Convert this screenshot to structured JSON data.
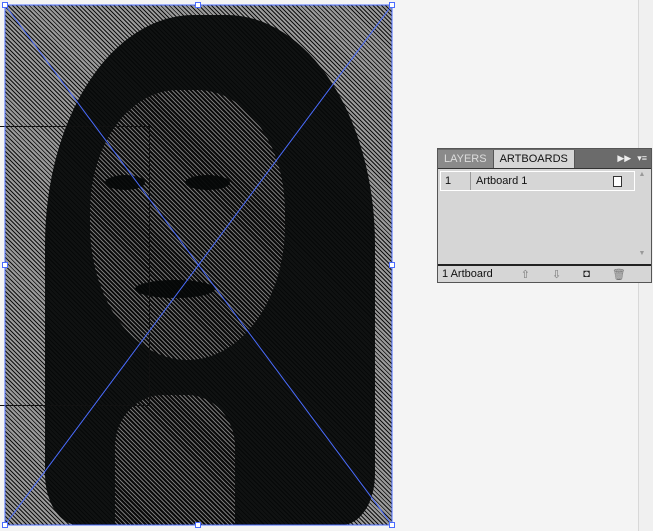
{
  "panel": {
    "tabs": [
      {
        "label": "LAYERS"
      },
      {
        "label": "ARTBOARDS"
      }
    ],
    "rows": [
      {
        "number": "1",
        "name": "Artboard 1"
      }
    ],
    "footer_count": "1 Artboard",
    "icons": [
      "move-up-icon",
      "move-down-icon",
      "new-artboard-icon",
      "delete-icon"
    ]
  },
  "colors": {
    "selection": "#4a6cff",
    "panel_bg": "#d6d6d6"
  }
}
